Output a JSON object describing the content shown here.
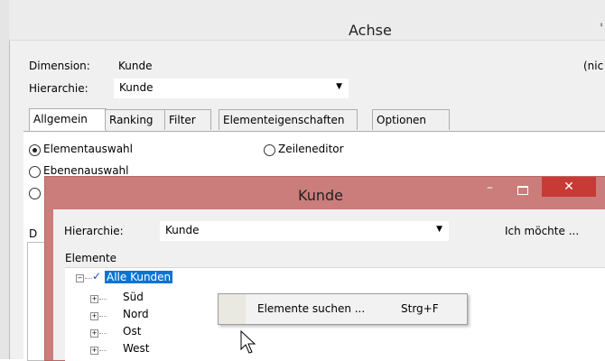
{
  "outer": {
    "title": "Achse",
    "title_right": "'",
    "dimension_label": "Dimension:",
    "dimension_value": "Kunde",
    "right_cut_text": "(nic",
    "hierarchy_label": "Hierarchie:",
    "hierarchy_value": "Kunde",
    "tabs": [
      {
        "label": "Allgemein"
      },
      {
        "label": "Ranking"
      },
      {
        "label": "Filter"
      },
      {
        "label": "Elementeigenschaften"
      },
      {
        "label": "Optionen"
      }
    ],
    "radio_element": "Elementauswahl",
    "radio_level": "Ebenenauswahl",
    "radio_line": "Zeileneditor",
    "left_cut_letter": "D"
  },
  "dialog": {
    "title": "Kunde",
    "minimize": "–",
    "close": "✕",
    "hierarchy_label": "Hierarchie:",
    "hierarchy_value": "Kunde",
    "i_want_label": "Ich möchte ...",
    "elements_label": "Elemente",
    "tree": {
      "root": "Alle Kunden",
      "children": [
        "Süd",
        "Nord",
        "Ost",
        "West"
      ]
    }
  },
  "context_menu": {
    "item_label": "Elemente suchen ...",
    "item_shortcut": "Strg+F"
  },
  "icons": {
    "checkmark": "check-icon",
    "tree_expand": "plus-box-icon",
    "tree_collapse": "minus-box-icon",
    "pointer": "mouse-pointer-icon"
  },
  "colors": {
    "dialog_frame": "#ca7d7b",
    "close_button": "#c73b36",
    "selection": "#0a74d4"
  }
}
